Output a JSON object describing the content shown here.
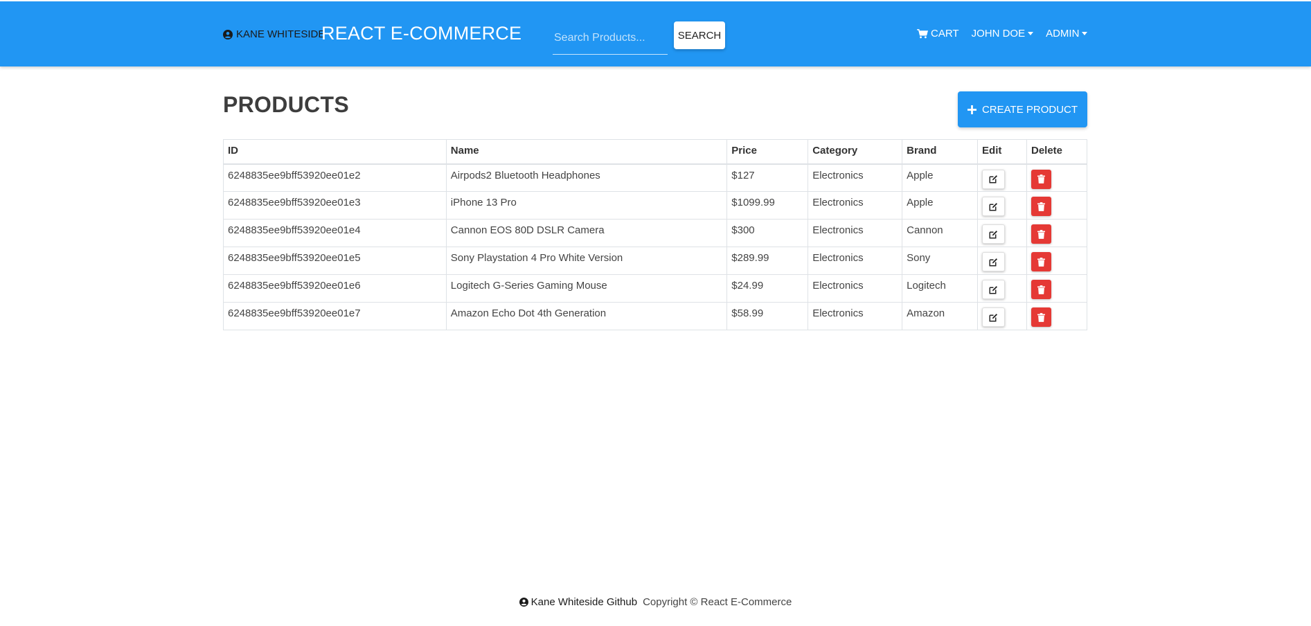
{
  "navbar": {
    "github_label": "Kane Whiteside",
    "brand_title": "React E-Commerce",
    "search_placeholder": "Search Products...",
    "search_button": "Search",
    "cart_label": "Cart",
    "user_menu": "John Doe",
    "admin_menu": "Admin",
    "bg_color": "#2196f3"
  },
  "main": {
    "title": "Products",
    "create_button": "Create Product",
    "table": {
      "headers": [
        "ID",
        "Name",
        "Price",
        "Category",
        "Brand",
        "Edit",
        "Delete"
      ],
      "rows": [
        {
          "id": "6248835ee9bff53920ee01e2",
          "name": "Airpods2 Bluetooth Headphones",
          "price": "$127",
          "category": "Electronics",
          "brand": "Apple"
        },
        {
          "id": "6248835ee9bff53920ee01e3",
          "name": "iPhone 13 Pro",
          "price": "$1099.99",
          "category": "Electronics",
          "brand": "Apple"
        },
        {
          "id": "6248835ee9bff53920ee01e4",
          "name": "Cannon EOS 80D DSLR Camera",
          "price": "$300",
          "category": "Electronics",
          "brand": "Cannon"
        },
        {
          "id": "6248835ee9bff53920ee01e5",
          "name": "Sony Playstation 4 Pro White Version",
          "price": "$289.99",
          "category": "Electronics",
          "brand": "Sony"
        },
        {
          "id": "6248835ee9bff53920ee01e6",
          "name": "Logitech G-Series Gaming Mouse",
          "price": "$24.99",
          "category": "Electronics",
          "brand": "Logitech"
        },
        {
          "id": "6248835ee9bff53920ee01e7",
          "name": "Amazon Echo Dot 4th Generation",
          "price": "$58.99",
          "category": "Electronics",
          "brand": "Amazon"
        }
      ]
    },
    "edit_icon": "edit-icon",
    "delete_icon": "trash-icon",
    "delete_color": "#e53935"
  },
  "footer": {
    "github_label": "Kane Whiteside Github",
    "copyright": "Copyright © React E-Commerce"
  }
}
